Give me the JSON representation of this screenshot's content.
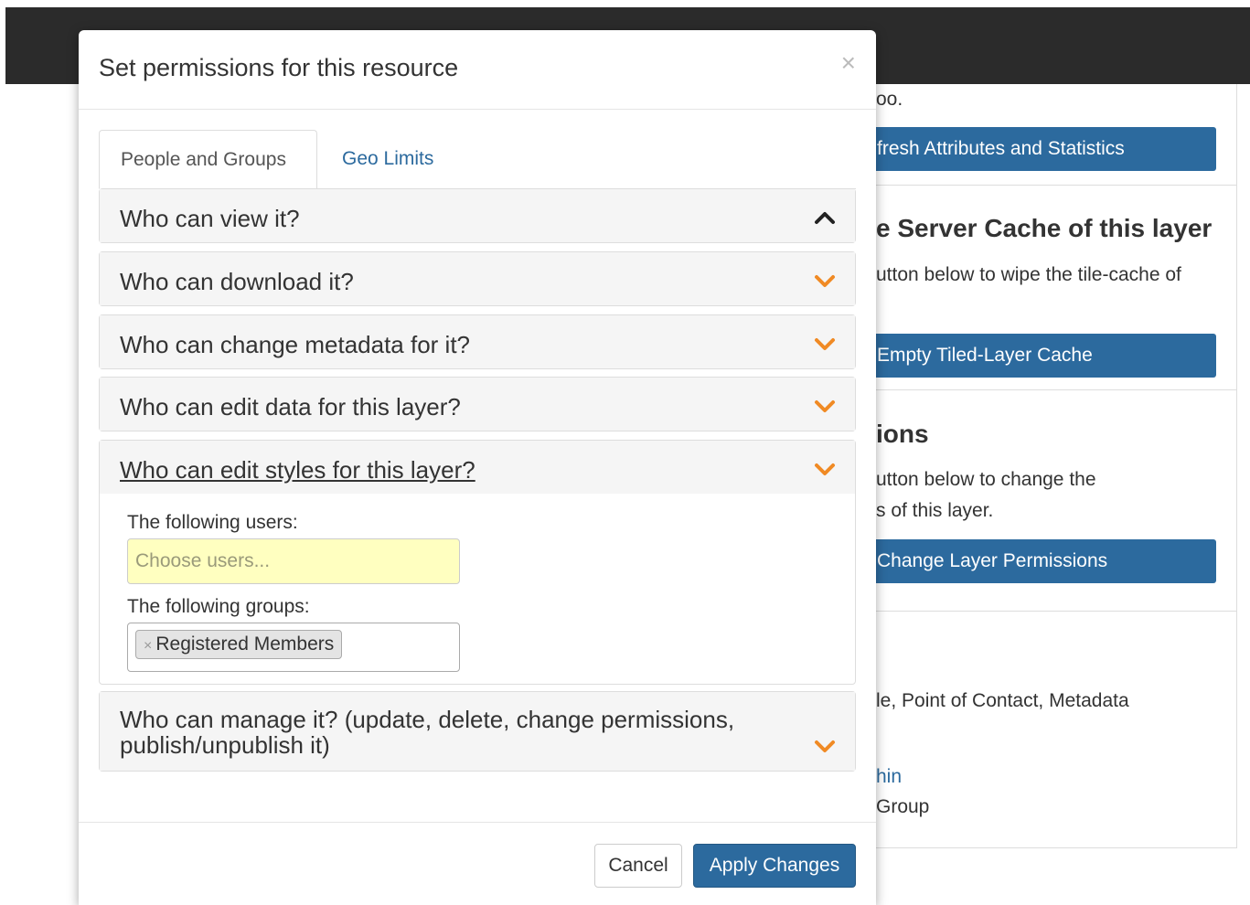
{
  "background": {
    "text_top": "oo.",
    "refresh_button": "fresh Attributes and Statistics",
    "cache_heading": "e Server Cache of this layer",
    "cache_text": "utton below to wipe the tile-cache of",
    "cache_button": "Empty Tiled-Layer Cache",
    "perm_heading": "ions",
    "perm_text_1": "utton below to change the",
    "perm_text_2": "s of this layer.",
    "perm_button": "Change Layer Permissions",
    "roles_text": "le, Point of Contact, Metadata",
    "admin_link": "hin",
    "group_text": "Group"
  },
  "modal": {
    "title": "Set permissions for this resource",
    "close_label": "×",
    "tabs": [
      {
        "label": "People and Groups"
      },
      {
        "label": "Geo Limits"
      }
    ],
    "panels": [
      {
        "title": "Who can view it?"
      },
      {
        "title": "Who can download it?"
      },
      {
        "title": "Who can change metadata for it?"
      },
      {
        "title": "Who can edit data for this layer?"
      },
      {
        "title": "Who can edit styles for this layer?"
      },
      {
        "title": "Who can manage it? (update, delete, change permissions, publish/unpublish it)"
      }
    ],
    "styles_panel": {
      "users_label": "The following users:",
      "users_placeholder": "Choose users...",
      "groups_label": "The following groups:",
      "group_chip_remove": "×",
      "group_chip": "Registered Members"
    },
    "cancel_label": "Cancel",
    "apply_label": "Apply Changes"
  },
  "colors": {
    "accent": "#2c6a9e",
    "chevron": "#f08a24",
    "topbar": "#2b2b2b",
    "input_highlight": "#ffffc0"
  },
  "icons": {
    "close": "close-icon",
    "collapse": "chevron-up-icon",
    "expand": "chevron-down-icon"
  }
}
